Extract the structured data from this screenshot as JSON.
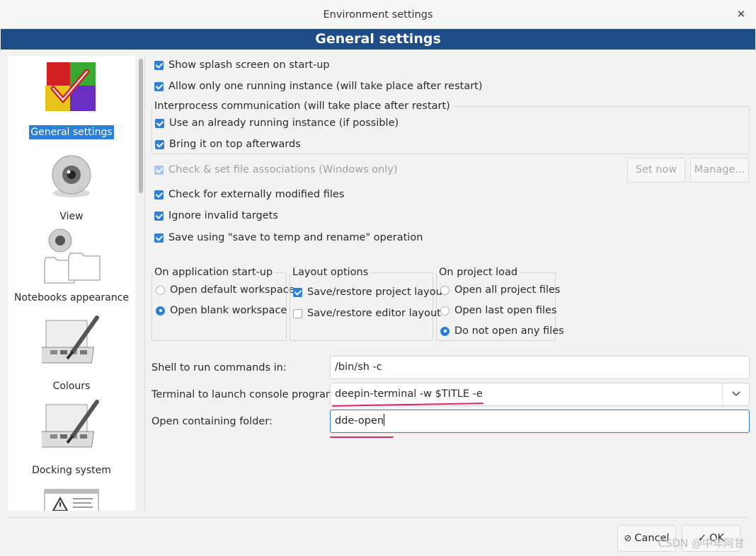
{
  "window": {
    "title": "Environment settings",
    "close_glyph": "✕"
  },
  "banner": {
    "title": "General settings"
  },
  "sidebar": {
    "items": [
      {
        "label": "General settings",
        "icon": "general-settings-icon",
        "active": true
      },
      {
        "label": "View",
        "icon": "eye-icon"
      },
      {
        "label": "Notebooks appearance",
        "icon": "notebooks-icon"
      },
      {
        "label": "Colours",
        "icon": "palette-icon"
      },
      {
        "label": "Docking system",
        "icon": "docking-icon"
      },
      {
        "label": "",
        "icon": "warning-icon"
      }
    ]
  },
  "options": {
    "splash": "Show splash screen on start-up",
    "single_instance": "Allow only one running instance (will take place after restart)",
    "ipc": {
      "title": "Interprocess communication (will take place after restart)",
      "use_running": "Use an already running instance (if possible)",
      "bring_top": "Bring it on top afterwards"
    },
    "file_assoc": "Check & set file associations (Windows only)",
    "set_now": "Set now",
    "manage": "Manage...",
    "ext_modified": "Check for externally modified files",
    "ignore_invalid": "Ignore invalid targets",
    "save_temp": "Save using \"save to temp and rename\" operation"
  },
  "startup": {
    "title": "On application start-up",
    "options": [
      "Open default workspace",
      "Open blank workspace"
    ],
    "selected": "Open blank workspace"
  },
  "layout": {
    "title": "Layout options",
    "project_layout": "Save/restore project layout",
    "editor_layout": "Save/restore editor layout"
  },
  "project_load": {
    "title": "On project load",
    "options": [
      "Open all project files",
      "Open last open files",
      "Do not open any files"
    ],
    "selected": "Do not open any files"
  },
  "fields": {
    "shell_label": "Shell to run commands in:",
    "shell_value": "/bin/sh -c",
    "terminal_label": "Terminal to launch console programs:",
    "terminal_value": "deepin-terminal  -w  $TITLE  -e",
    "folder_label": "Open containing folder:",
    "folder_value": "dde-open"
  },
  "footer": {
    "cancel": "Cancel",
    "cancel_icon": "⊘",
    "ok": "OK",
    "ok_icon": "✓"
  },
  "watermark": "CSDN @中年阿甘",
  "colors": {
    "accent": "#2f7fd4",
    "banner": "#1d4c86",
    "annotation": "#e0245e"
  }
}
